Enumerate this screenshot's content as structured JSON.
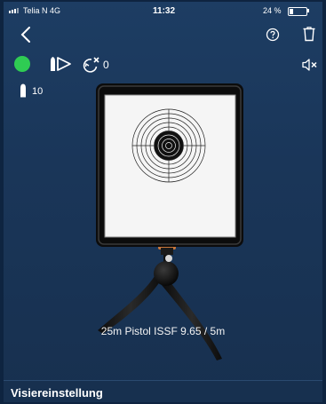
{
  "status_bar": {
    "carrier": "Telia N  4G",
    "time": "11:32",
    "battery_percent": "24 %",
    "battery_level": 0.24
  },
  "nav": {
    "back_icon": "chevron-left-icon",
    "help_icon": "question-circle-icon",
    "delete_icon": "trash-icon"
  },
  "toolbar": {
    "status_color": "#2fcc53",
    "play_icon": "bullet-play-icon",
    "reset_icon": "reset-shots-icon",
    "shot_count": "0",
    "sound_icon": "speaker-muted-icon"
  },
  "ammo": {
    "icon": "bullet-icon",
    "count": "10"
  },
  "target": {
    "name": "25m Pistol ISSF 9.65 / 5m"
  },
  "bottom": {
    "label": "Visiereinstellung"
  },
  "colors": {
    "background": "#1a3659",
    "accent_green": "#2fcc53"
  }
}
